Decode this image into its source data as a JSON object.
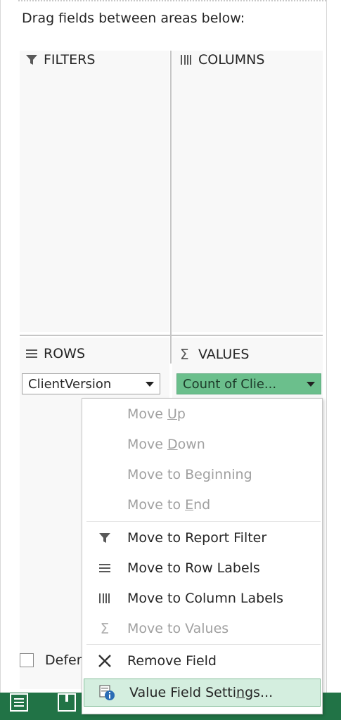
{
  "pane": {
    "instruction": "Drag fields between areas below:"
  },
  "areas": {
    "filters": {
      "label": "FILTERS",
      "icon": "filter-icon"
    },
    "columns": {
      "label": "COLUMNS",
      "icon": "columns-icon"
    },
    "rows": {
      "label": "ROWS",
      "icon": "rows-icon",
      "field": "ClientVersion"
    },
    "values": {
      "label": "VALUES",
      "icon": "sigma-icon",
      "symbol": "Σ",
      "field": "Count of Clie..."
    }
  },
  "defer": {
    "label": "Defer"
  },
  "context_menu": {
    "items": [
      {
        "pre": "Move ",
        "key": "U",
        "post": "p",
        "enabled": false,
        "icon": ""
      },
      {
        "pre": "Move ",
        "key": "D",
        "post": "own",
        "enabled": false,
        "icon": ""
      },
      {
        "pre": "Move to Be",
        "key": "g",
        "post": "inning",
        "enabled": false,
        "icon": ""
      },
      {
        "pre": "Move to ",
        "key": "E",
        "post": "nd",
        "enabled": false,
        "icon": ""
      },
      {
        "pre": "Move to Report Filter",
        "key": "",
        "post": "",
        "enabled": true,
        "icon": "filter-icon"
      },
      {
        "pre": "Move to Row Labels",
        "key": "",
        "post": "",
        "enabled": true,
        "icon": "rows-icon"
      },
      {
        "pre": "Move to Column Labels",
        "key": "",
        "post": "",
        "enabled": true,
        "icon": "columns-icon"
      },
      {
        "pre": "Move to Values",
        "key": "",
        "post": "",
        "enabled": false,
        "icon": "sigma-icon"
      },
      {
        "pre": "Remove Field",
        "key": "",
        "post": "",
        "enabled": true,
        "icon": "close-icon"
      },
      {
        "pre": "Value Field Setti",
        "key": "n",
        "post": "gs...",
        "enabled": true,
        "selected": true,
        "icon": "field-settings-icon"
      }
    ],
    "sigma": "Σ"
  },
  "colors": {
    "accent": "#217346",
    "values_pill": "#6bbf8c",
    "selected_item": "#d4eedf"
  }
}
